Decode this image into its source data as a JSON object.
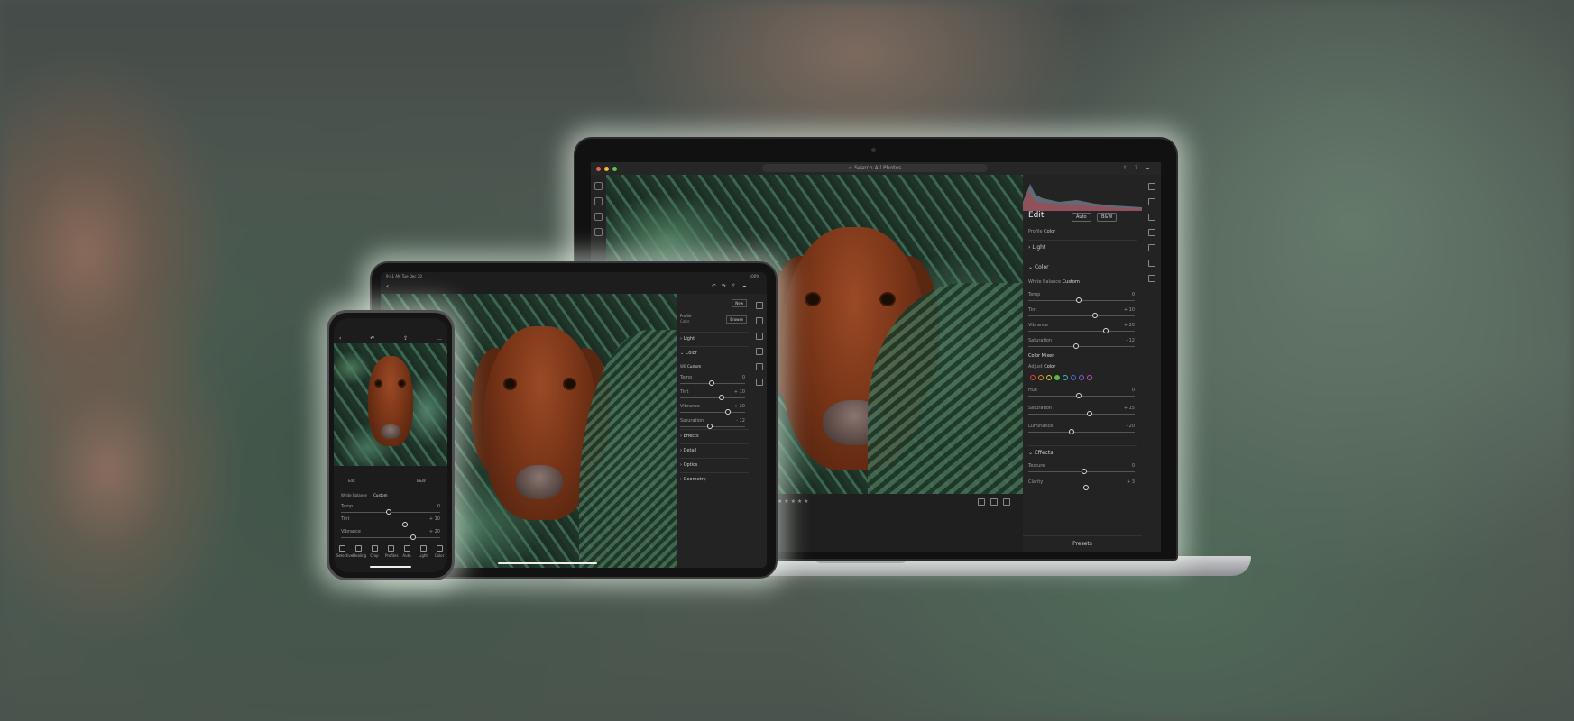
{
  "desktop": {
    "search_placeholder": "Search All Photos",
    "panel_title": "Edit",
    "auto_label": "Auto",
    "bw_label": "B&W",
    "profile_label": "Profile",
    "profile_value": "Color",
    "sections": {
      "light": "Light",
      "color": "Color",
      "effects": "Effects"
    },
    "white_balance_label": "White Balance",
    "white_balance_value": "Custom",
    "sliders": [
      {
        "label": "Temp",
        "value": "0",
        "level": 0.45
      },
      {
        "label": "Tint",
        "value": "+ 10",
        "level": 0.6
      },
      {
        "label": "Vibrance",
        "value": "+ 20",
        "level": 0.7
      },
      {
        "label": "Saturation",
        "value": "- 12",
        "level": 0.42
      }
    ],
    "color_mixer_label": "Color Mixer",
    "adjust_label": "Adjust",
    "adjust_value": "Color",
    "mixer_dots": [
      "#d24a3c",
      "#e08a2c",
      "#d9c33a",
      "#5ab84a",
      "#3fb8b8",
      "#4a6ad8",
      "#8a5ad8",
      "#c24ac0"
    ],
    "mixer_sliders": [
      {
        "label": "Hue",
        "value": "0",
        "level": 0.45
      },
      {
        "label": "Saturation",
        "value": "+ 15",
        "level": 0.55
      },
      {
        "label": "Luminance",
        "value": "- 20",
        "level": 0.38
      }
    ],
    "effects_sliders": [
      {
        "label": "Texture",
        "value": "0",
        "level": 0.5
      },
      {
        "label": "Clarity",
        "value": "+ 3",
        "level": 0.52
      }
    ],
    "presets_label": "Presets",
    "rating_stars": "★ ★ ★ ★ ★"
  },
  "tablet": {
    "status_time": "9:41 AM  Tue Dec 20",
    "battery": "100%",
    "new_label": "New",
    "profile_label": "Profile",
    "profile_value": "Color",
    "browse_label": "Browse",
    "sections": [
      "Light",
      "Color",
      "Effects",
      "Detail",
      "Optics",
      "Geometry"
    ],
    "wb_label": "WB",
    "wb_value": "Custom",
    "sliders": [
      {
        "label": "Temp",
        "value": "0",
        "level": 0.45
      },
      {
        "label": "Tint",
        "value": "+ 10",
        "level": 0.6
      },
      {
        "label": "Vibrance",
        "value": "+ 20",
        "level": 0.7
      },
      {
        "label": "Saturation",
        "value": "- 12",
        "level": 0.42
      }
    ]
  },
  "phone": {
    "edit_label": "Edit",
    "bw_label": "B&W",
    "white_balance_label": "White Balance",
    "white_balance_value": "Custom",
    "sliders": [
      {
        "label": "Temp",
        "value": "0",
        "level": 0.45
      },
      {
        "label": "Tint",
        "value": "+ 10",
        "level": 0.62
      },
      {
        "label": "Vibrance",
        "value": "+ 20",
        "level": 0.7
      }
    ],
    "tools": [
      "Selective",
      "Healing",
      "Crop",
      "Profiles",
      "Auto",
      "Light",
      "Color"
    ]
  }
}
